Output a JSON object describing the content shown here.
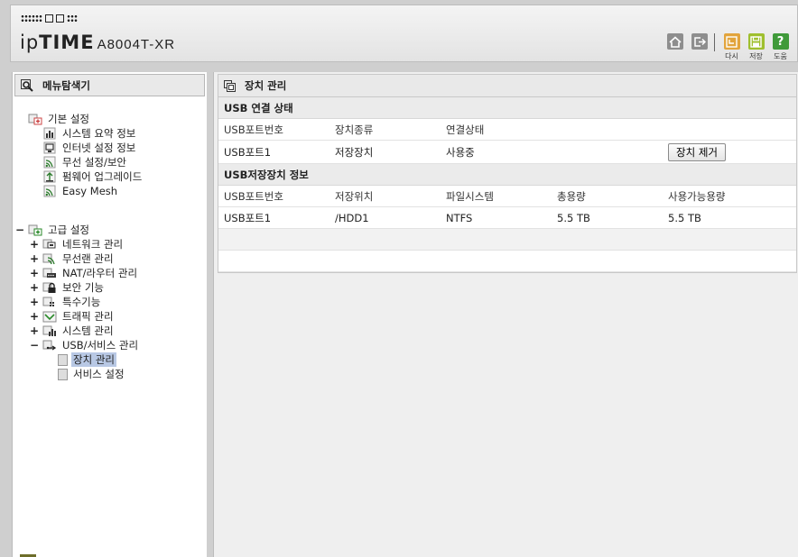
{
  "header": {
    "brand_ip": "ip",
    "brand_time": "TIME",
    "model": "A8004T-XR",
    "buttons": {
      "redo_label": "다시",
      "save_label": "저장",
      "help_label": "도움",
      "help_glyph": "?"
    }
  },
  "sidebar": {
    "title": "메뉴탐색기",
    "basic": {
      "label": "기본 설정",
      "items": [
        {
          "label": "시스템 요약 정보",
          "icon": "bar-chart-icon"
        },
        {
          "label": "인터넷 설정 정보",
          "icon": "monitor-icon"
        },
        {
          "label": "무선 설정/보안",
          "icon": "wireless-icon"
        },
        {
          "label": "펌웨어 업그레이드",
          "icon": "upgrade-icon"
        },
        {
          "label": "Easy Mesh",
          "icon": "wireless-icon"
        }
      ]
    },
    "advanced": {
      "toggle": "−",
      "label": "고급 설정",
      "items": [
        {
          "toggle": "+",
          "label": "네트워크 관리",
          "icon": "network-icon"
        },
        {
          "toggle": "+",
          "label": "무선랜 관리",
          "icon": "wireless-icon"
        },
        {
          "toggle": "+",
          "label": "NAT/라우터 관리",
          "icon": "router-icon"
        },
        {
          "toggle": "+",
          "label": "보안 기능",
          "icon": "lock-icon"
        },
        {
          "toggle": "+",
          "label": "특수기능",
          "icon": "special-icon"
        },
        {
          "toggle": "+",
          "label": "트래픽 관리",
          "icon": "traffic-icon"
        },
        {
          "toggle": "+",
          "label": "시스템 관리",
          "icon": "bar-chart-icon"
        },
        {
          "toggle": "−",
          "label": "USB/서비스 관리",
          "icon": "usb-icon"
        }
      ],
      "usb_children": [
        {
          "label": "장치 관리",
          "selected": true
        },
        {
          "label": "서비스 설정",
          "selected": false
        }
      ]
    }
  },
  "main": {
    "title": "장치 관리",
    "usb_status": {
      "title": "USB 연결 상태",
      "columns": [
        "USB포트번호",
        "장치종류",
        "연결상태"
      ],
      "rows": [
        {
          "port": "USB포트1",
          "type": "저장장치",
          "status": "사용중",
          "action": "장치 제거"
        }
      ]
    },
    "usb_storage": {
      "title": "USB저장장치 정보",
      "columns": [
        "USB포트번호",
        "저장위치",
        "파일시스템",
        "총용량",
        "사용가능용량"
      ],
      "rows": [
        {
          "port": "USB포트1",
          "location": "/HDD1",
          "fs": "NTFS",
          "total": "5.5 TB",
          "available": "5.5 TB"
        }
      ]
    }
  }
}
